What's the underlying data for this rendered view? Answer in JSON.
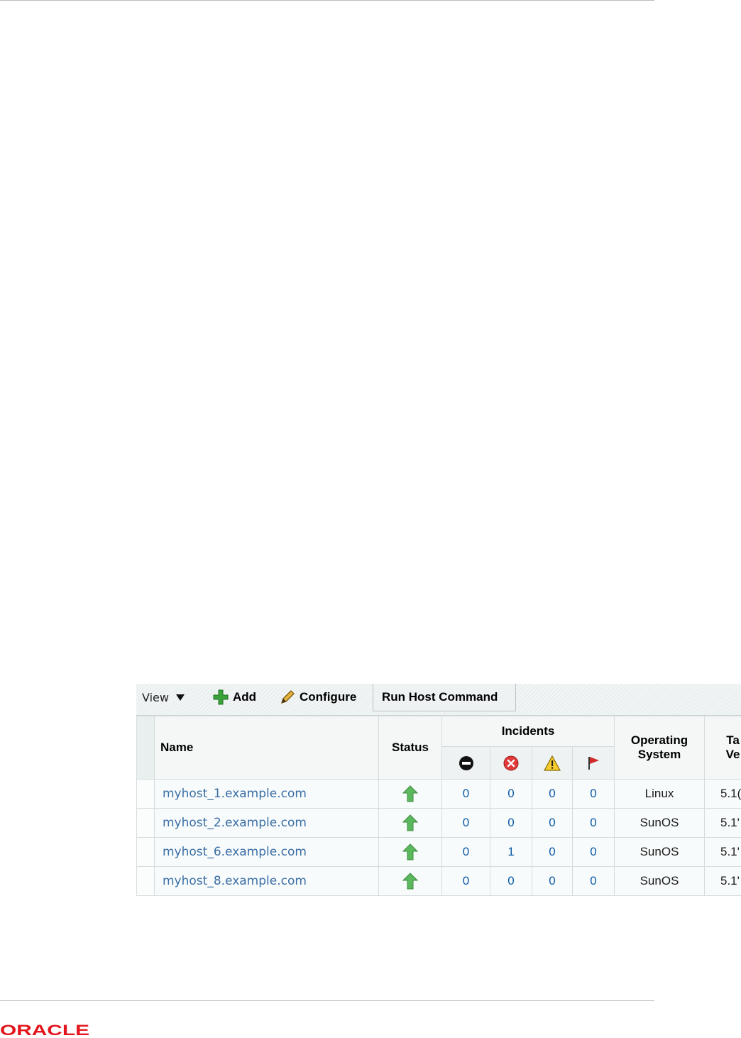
{
  "toolbar": {
    "view_label": "View",
    "add_label": "Add",
    "configure_label": "Configure",
    "run_label": "Run Host Command"
  },
  "table": {
    "headers": {
      "name": "Name",
      "status": "Status",
      "incidents": "Incidents",
      "os_line1": "Operating",
      "os_line2": "System",
      "ver_line1": "Ta",
      "ver_line2": "Ve"
    },
    "incident_icons": [
      "fatal-icon",
      "critical-icon",
      "warning-icon",
      "escalated-flag-icon"
    ],
    "status_icon": "status-up-arrow-icon",
    "rows": [
      {
        "name": "myhost_1.example.com",
        "c0": "0",
        "c1": "0",
        "c2": "0",
        "c3": "0",
        "os": "Linux",
        "ver": "5.1("
      },
      {
        "name": "myhost_2.example.com",
        "c0": "0",
        "c1": "0",
        "c2": "0",
        "c3": "0",
        "os": "SunOS",
        "ver": "5.1'"
      },
      {
        "name": "myhost_6.example.com",
        "c0": "0",
        "c1": "1",
        "c2": "0",
        "c3": "0",
        "os": "SunOS",
        "ver": "5.1'"
      },
      {
        "name": "myhost_8.example.com",
        "c0": "0",
        "c1": "0",
        "c2": "0",
        "c3": "0",
        "os": "SunOS",
        "ver": "5.1'"
      }
    ]
  },
  "footer": {
    "logo_text": "ORACLE"
  },
  "colors": {
    "link": "#3a6ea5",
    "count": "#0b5aa6",
    "status_up": "#5cb85c",
    "oracle_red": "#e3141b"
  }
}
